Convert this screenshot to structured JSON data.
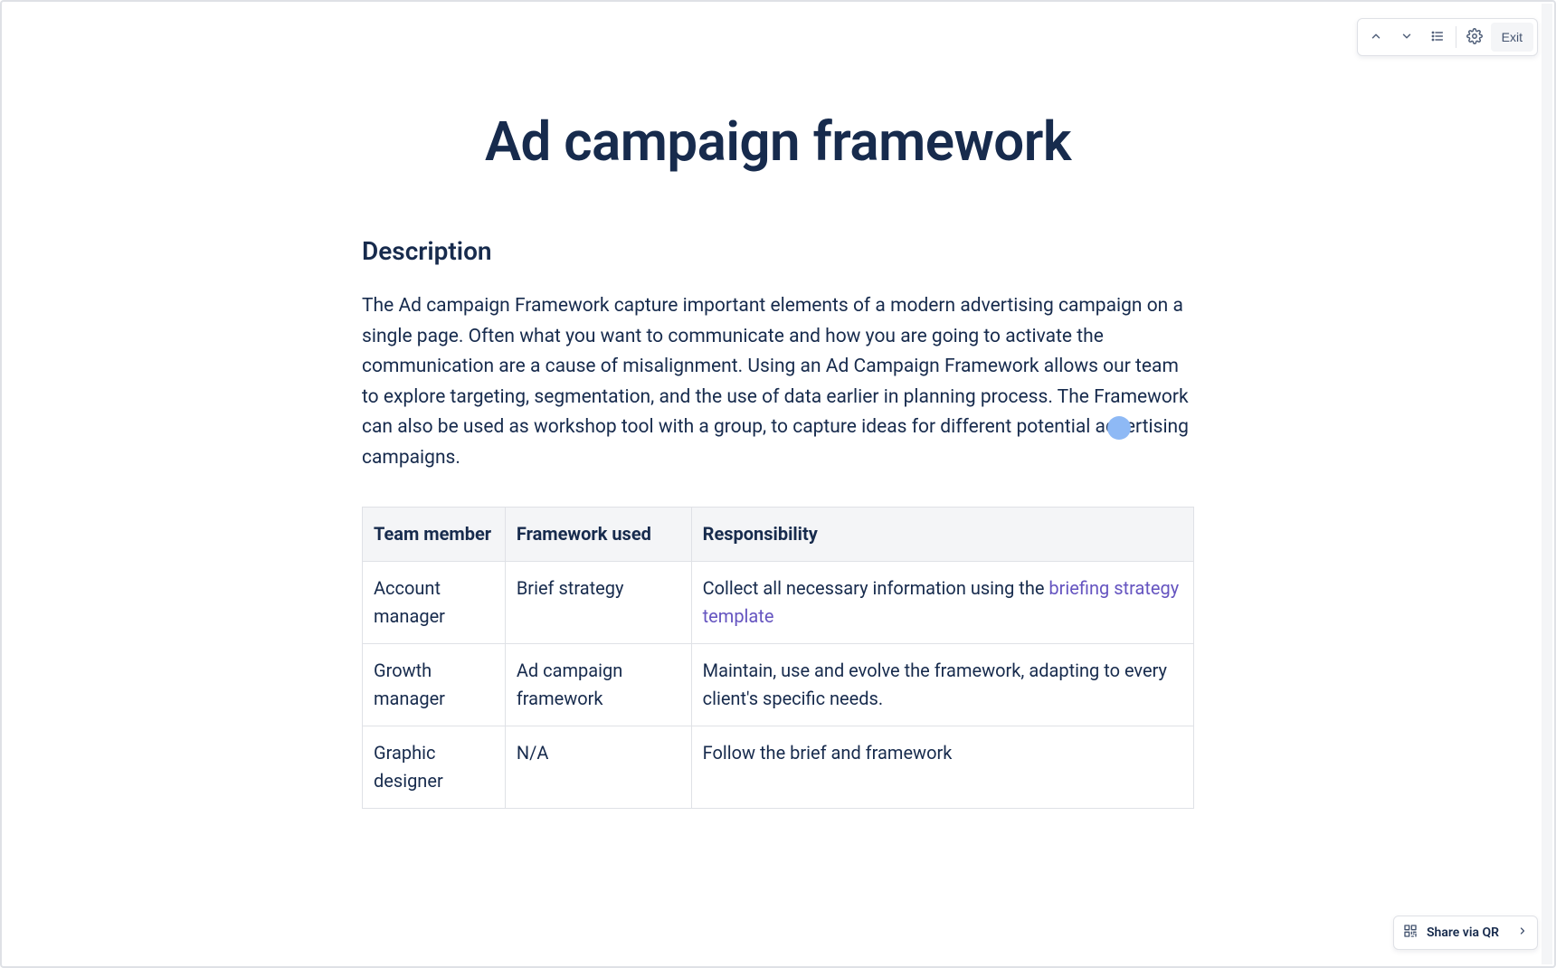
{
  "toolbar": {
    "exit_label": "Exit"
  },
  "page": {
    "title": "Ad campaign framework",
    "description_heading": "Description",
    "description_body": "The Ad campaign Framework capture important elements of a modern advertising campaign on a single page.  Often what you want to communicate and how you are going to activate the communication are a cause of misalignment.  Using an Ad Campaign Framework allows our team to explore targeting, segmentation, and the use of data earlier in planning process.  The Framework can also be used as workshop tool with a group, to capture ideas for different potential advertising campaigns."
  },
  "table": {
    "headers": [
      "Team member",
      "Framework used",
      "Responsibility"
    ],
    "rows": [
      {
        "member": "Account manager",
        "framework": "Brief strategy",
        "responsibility_prefix": "Collect all necessary information using the ",
        "responsibility_link": "briefing strategy template",
        "responsibility_suffix": ""
      },
      {
        "member": "Growth manager",
        "framework": "Ad campaign framework",
        "responsibility_prefix": "Maintain, use and evolve the framework, adapting to every client's specific needs.",
        "responsibility_link": "",
        "responsibility_suffix": ""
      },
      {
        "member": "Graphic designer",
        "framework": "N/A",
        "responsibility_prefix": "Follow the brief and framework",
        "responsibility_link": "",
        "responsibility_suffix": ""
      }
    ]
  },
  "share": {
    "label": "Share via QR"
  }
}
